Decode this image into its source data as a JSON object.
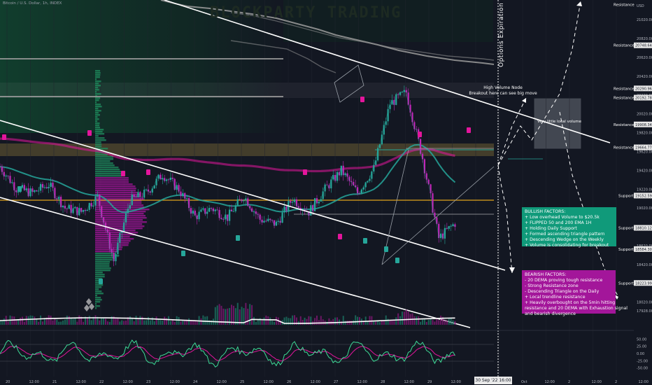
{
  "header": {
    "symbol_title": "Bitcoin / U.S. Dollar, 1h, INDEX",
    "watermark": "BLOCKPARTY TRADING",
    "currency": "USD"
  },
  "annotations": {
    "options_expiration": "Options Expiration",
    "high_volume_node": [
      "High Volume Node",
      "Breakout here can see big move"
    ],
    "low_volume": "Very little local volume",
    "bullish_factors": [
      "BULLISH FACTORS:",
      "+ Low overhead Volume to $20.5k",
      "+ FLIPPED 50 and 200 EMA 1H",
      "+ Holding Daily Support",
      "+ Formed ascending triangle pattern",
      "+ Descending Wedge on the Weekly",
      "+ Volume is consolidating for breakout"
    ],
    "bearish_factors": [
      "BEARISH FACTORS:",
      "- 20 DEMA proving tough resistance",
      "- Strong Resistance zone",
      "- Descending Triangle on the Daily",
      "+ Local trendline resistance",
      "+ Heavily overbought on the 5min hitting",
      "resistance and 20 DEMA with Exhaustion signal",
      "and bearish divergence"
    ],
    "cursor_time": "30 Sep '22   16:00"
  },
  "chart_data": {
    "type": "candlestick",
    "title": "Bitcoin / U.S. Dollar, 1h, INDEX",
    "ylabel": "USD",
    "ylim": [
      17780,
      21230
    ],
    "y_ticks": [
      17928,
      18020,
      18220,
      18420,
      18620,
      18820,
      19020,
      19220,
      19420,
      19620,
      19820,
      20020,
      20220,
      20420,
      20620,
      20820,
      21020
    ],
    "x_ticks": [
      "20",
      "12:00",
      "21",
      "12:00",
      "22",
      "12:00",
      "23",
      "12:00",
      "24",
      "12:00",
      "25",
      "12:00",
      "26",
      "12:00",
      "27",
      "12:00",
      "28",
      "12:00",
      "29",
      "12:00",
      "30",
      "12:00",
      "Oct",
      "12:00",
      "2",
      "12:00",
      "2",
      "12:00"
    ],
    "x_range_hours": [
      0,
      312
    ],
    "price_series": {
      "name": "BTCUSD",
      "x_hours": [
        0,
        8,
        16,
        24,
        32,
        40,
        48,
        56,
        64,
        72,
        80,
        88,
        96,
        104,
        112,
        120,
        128,
        136,
        144,
        152,
        160,
        168,
        176,
        184,
        192,
        200,
        208,
        216,
        224
      ],
      "close": [
        19460,
        19230,
        19180,
        19270,
        19020,
        18980,
        19140,
        18460,
        19100,
        19180,
        19380,
        19220,
        18930,
        19020,
        18920,
        19150,
        18900,
        18850,
        19120,
        18980,
        19220,
        19420,
        19180,
        19440,
        20130,
        20250,
        19550,
        18700,
        18860
      ]
    },
    "resistance_levels": [
      21182,
      20748.64,
      20290.96,
      20192.78,
      19908.34,
      19664.77
    ],
    "resistance_labels": [
      "Resistance",
      "20748.64",
      "20290.96",
      "20192.78",
      "19908.34",
      "19664.77"
    ],
    "support_levels": [
      19152.59,
      18810.12,
      18584.3,
      18223.99
    ],
    "support_labels": [
      "19152.59",
      "18810.12",
      "18584.30",
      "18223.99"
    ],
    "level_word_resistance": "Resistance",
    "level_word_support": "Support",
    "oscillator": {
      "name": "RSI",
      "ylim": [
        -75,
        75
      ],
      "ticks": [
        50,
        25,
        0,
        -25,
        -50
      ],
      "tick_labels": [
        "50.00",
        "25.00",
        "0.00",
        "-25.00",
        "-50.00"
      ]
    },
    "colors": {
      "up": "#26a69a",
      "down": "#c026b8",
      "resistance_line": "#b0b0b0",
      "ema": "#e4159c",
      "trendline": "#ffffff",
      "support_line": "#e0a31d"
    }
  }
}
